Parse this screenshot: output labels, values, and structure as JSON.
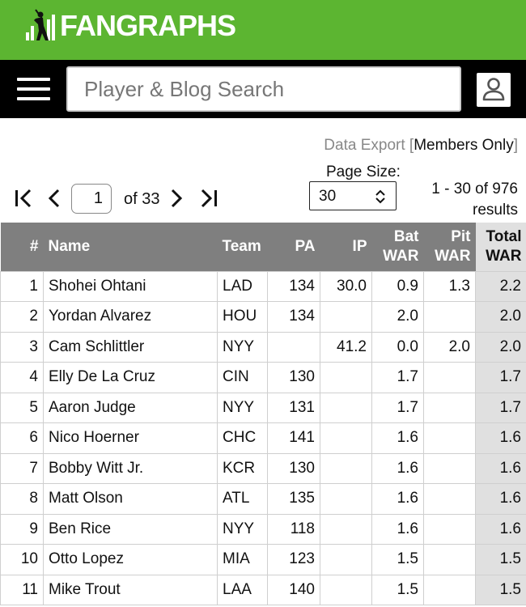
{
  "header": {
    "logo_text": "FANGRAPHS",
    "brand_color": "#5cb531"
  },
  "nav": {
    "menu_icon": "hamburger-icon",
    "search_placeholder": "Player & Blog Search",
    "user_icon": "user-icon"
  },
  "export": {
    "label": "Data Export",
    "open_bracket": "[",
    "members_label": "Members Only",
    "close_bracket": "]"
  },
  "pager": {
    "first_icon": "first-page-icon",
    "prev_icon": "prev-page-icon",
    "current_page": "1",
    "of_label": "of 33",
    "next_icon": "next-page-icon",
    "last_icon": "last-page-icon",
    "page_size_label": "Page Size:",
    "page_size_value": "30",
    "results_range": "1 - 30 of 976",
    "results_word": "results"
  },
  "table": {
    "columns": [
      {
        "line1": "#",
        "line2": ""
      },
      {
        "line1": "Name",
        "line2": ""
      },
      {
        "line1": "Team",
        "line2": ""
      },
      {
        "line1": "PA",
        "line2": ""
      },
      {
        "line1": "IP",
        "line2": ""
      },
      {
        "line1": "Bat",
        "line2": "WAR"
      },
      {
        "line1": "Pit",
        "line2": "WAR"
      },
      {
        "line1": "Total",
        "line2": "WAR"
      }
    ],
    "rows": [
      {
        "rank": "1",
        "name": "Shohei Ohtani",
        "team": "LAD",
        "pa": "134",
        "ip": "30.0",
        "bat": "0.9",
        "pit": "1.3",
        "war": "2.2"
      },
      {
        "rank": "2",
        "name": "Yordan Alvarez",
        "team": "HOU",
        "pa": "134",
        "ip": "",
        "bat": "2.0",
        "pit": "",
        "war": "2.0"
      },
      {
        "rank": "3",
        "name": "Cam Schlittler",
        "team": "NYY",
        "pa": "",
        "ip": "41.2",
        "bat": "0.0",
        "pit": "2.0",
        "war": "2.0"
      },
      {
        "rank": "4",
        "name": "Elly De La Cruz",
        "team": "CIN",
        "pa": "130",
        "ip": "",
        "bat": "1.7",
        "pit": "",
        "war": "1.7"
      },
      {
        "rank": "5",
        "name": "Aaron Judge",
        "team": "NYY",
        "pa": "131",
        "ip": "",
        "bat": "1.7",
        "pit": "",
        "war": "1.7"
      },
      {
        "rank": "6",
        "name": "Nico Hoerner",
        "team": "CHC",
        "pa": "141",
        "ip": "",
        "bat": "1.6",
        "pit": "",
        "war": "1.6"
      },
      {
        "rank": "7",
        "name": "Bobby Witt Jr.",
        "team": "KCR",
        "pa": "130",
        "ip": "",
        "bat": "1.6",
        "pit": "",
        "war": "1.6"
      },
      {
        "rank": "8",
        "name": "Matt Olson",
        "team": "ATL",
        "pa": "135",
        "ip": "",
        "bat": "1.6",
        "pit": "",
        "war": "1.6"
      },
      {
        "rank": "9",
        "name": "Ben Rice",
        "team": "NYY",
        "pa": "118",
        "ip": "",
        "bat": "1.6",
        "pit": "",
        "war": "1.6"
      },
      {
        "rank": "10",
        "name": "Otto Lopez",
        "team": "MIA",
        "pa": "123",
        "ip": "",
        "bat": "1.5",
        "pit": "",
        "war": "1.5"
      },
      {
        "rank": "11",
        "name": "Mike Trout",
        "team": "LAA",
        "pa": "140",
        "ip": "",
        "bat": "1.5",
        "pit": "",
        "war": "1.5"
      }
    ]
  }
}
